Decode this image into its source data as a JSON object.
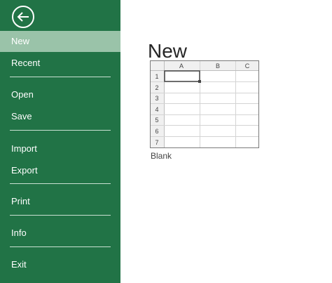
{
  "sidebar": {
    "back_icon": "back-arrow-icon",
    "items": [
      {
        "label": "New",
        "selected": true
      },
      {
        "label": "Recent"
      },
      {
        "label": "Open"
      },
      {
        "label": "Save"
      },
      {
        "label": "Import"
      },
      {
        "label": "Export"
      },
      {
        "label": "Print"
      },
      {
        "label": "Info"
      },
      {
        "label": "Exit"
      }
    ]
  },
  "main": {
    "title": "New",
    "templates": [
      {
        "label": "Blank",
        "columns": [
          "A",
          "B",
          "C"
        ],
        "rows": [
          "1",
          "2",
          "3",
          "4",
          "5",
          "6",
          "7"
        ]
      }
    ]
  },
  "colors": {
    "sidebar_bg": "#217346",
    "selected_bg": "#9ac3a9",
    "text_light": "#ffffff"
  }
}
